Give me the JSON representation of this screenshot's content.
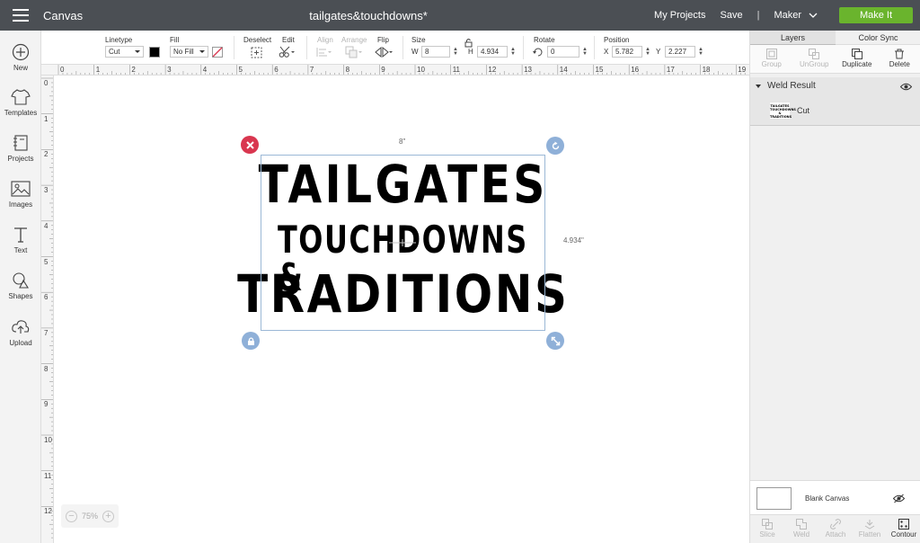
{
  "topbar": {
    "app_title": "Canvas",
    "doc_title": "tailgates&touchdowns*",
    "my_projects": "My Projects",
    "save": "Save",
    "separator": "|",
    "machine": "Maker",
    "make_it": "Make It"
  },
  "leftbar": {
    "items": [
      {
        "label": "New",
        "icon": "plus-circle-icon"
      },
      {
        "label": "Templates",
        "icon": "shirt-icon"
      },
      {
        "label": "Projects",
        "icon": "notebook-icon"
      },
      {
        "label": "Images",
        "icon": "image-icon"
      },
      {
        "label": "Text",
        "icon": "text-icon"
      },
      {
        "label": "Shapes",
        "icon": "shapes-icon"
      },
      {
        "label": "Upload",
        "icon": "cloud-upload-icon"
      }
    ]
  },
  "toolbar": {
    "linetype_label": "Linetype",
    "linetype_value": "Cut",
    "linetype_color": "#000000",
    "fill_label": "Fill",
    "fill_value": "No Fill",
    "deselect_label": "Deselect",
    "edit_label": "Edit",
    "align_label": "Align",
    "arrange_label": "Arrange",
    "flip_label": "Flip",
    "size_label": "Size",
    "w_label": "W",
    "w_value": "8",
    "h_label": "H",
    "h_value": "4.934",
    "rotate_label": "Rotate",
    "rotate_value": "0",
    "position_label": "Position",
    "x_label": "X",
    "x_value": "5.782",
    "y_label": "Y",
    "y_value": "2.227"
  },
  "rulers": {
    "horizontal": [
      "0",
      "1",
      "2",
      "3",
      "4",
      "5",
      "6",
      "7",
      "8",
      "9",
      "10",
      "11",
      "12",
      "13",
      "14",
      "15",
      "16",
      "17",
      "18",
      "19"
    ],
    "vertical": [
      "0",
      "1",
      "2",
      "3",
      "4",
      "5",
      "6",
      "7",
      "8",
      "9",
      "10",
      "11",
      "12"
    ]
  },
  "canvas": {
    "design_lines": [
      "TAILGATES",
      "TOUCHDOWNS &",
      "TRADITIONS"
    ],
    "width_dim": "8\"",
    "height_dim": "4.934\"",
    "zoom": "75%",
    "colors": {
      "delete_handle": "#d9364f",
      "handle": "#8fb0d8",
      "selection": "#9bb8d6"
    }
  },
  "rightpanel": {
    "tabs": [
      "Layers",
      "Color Sync"
    ],
    "actions": [
      {
        "label": "Group",
        "icon": "group-icon",
        "enabled": false
      },
      {
        "label": "UnGroup",
        "icon": "ungroup-icon",
        "enabled": false
      },
      {
        "label": "Duplicate",
        "icon": "duplicate-icon",
        "enabled": true
      },
      {
        "label": "Delete",
        "icon": "trash-icon",
        "enabled": true
      }
    ],
    "layer_group_title": "Weld Result",
    "layer_item_label": "Cut",
    "thumb_lines": [
      "TAILGATES",
      "TOUCHDOWNS &",
      "TRADITIONS"
    ],
    "blank_canvas_label": "Blank Canvas",
    "bottom_actions": [
      {
        "label": "Slice",
        "icon": "slice-icon",
        "enabled": false
      },
      {
        "label": "Weld",
        "icon": "weld-icon",
        "enabled": false
      },
      {
        "label": "Attach",
        "icon": "attach-icon",
        "enabled": false
      },
      {
        "label": "Flatten",
        "icon": "flatten-icon",
        "enabled": false
      },
      {
        "label": "Contour",
        "icon": "contour-icon",
        "enabled": true
      }
    ]
  }
}
